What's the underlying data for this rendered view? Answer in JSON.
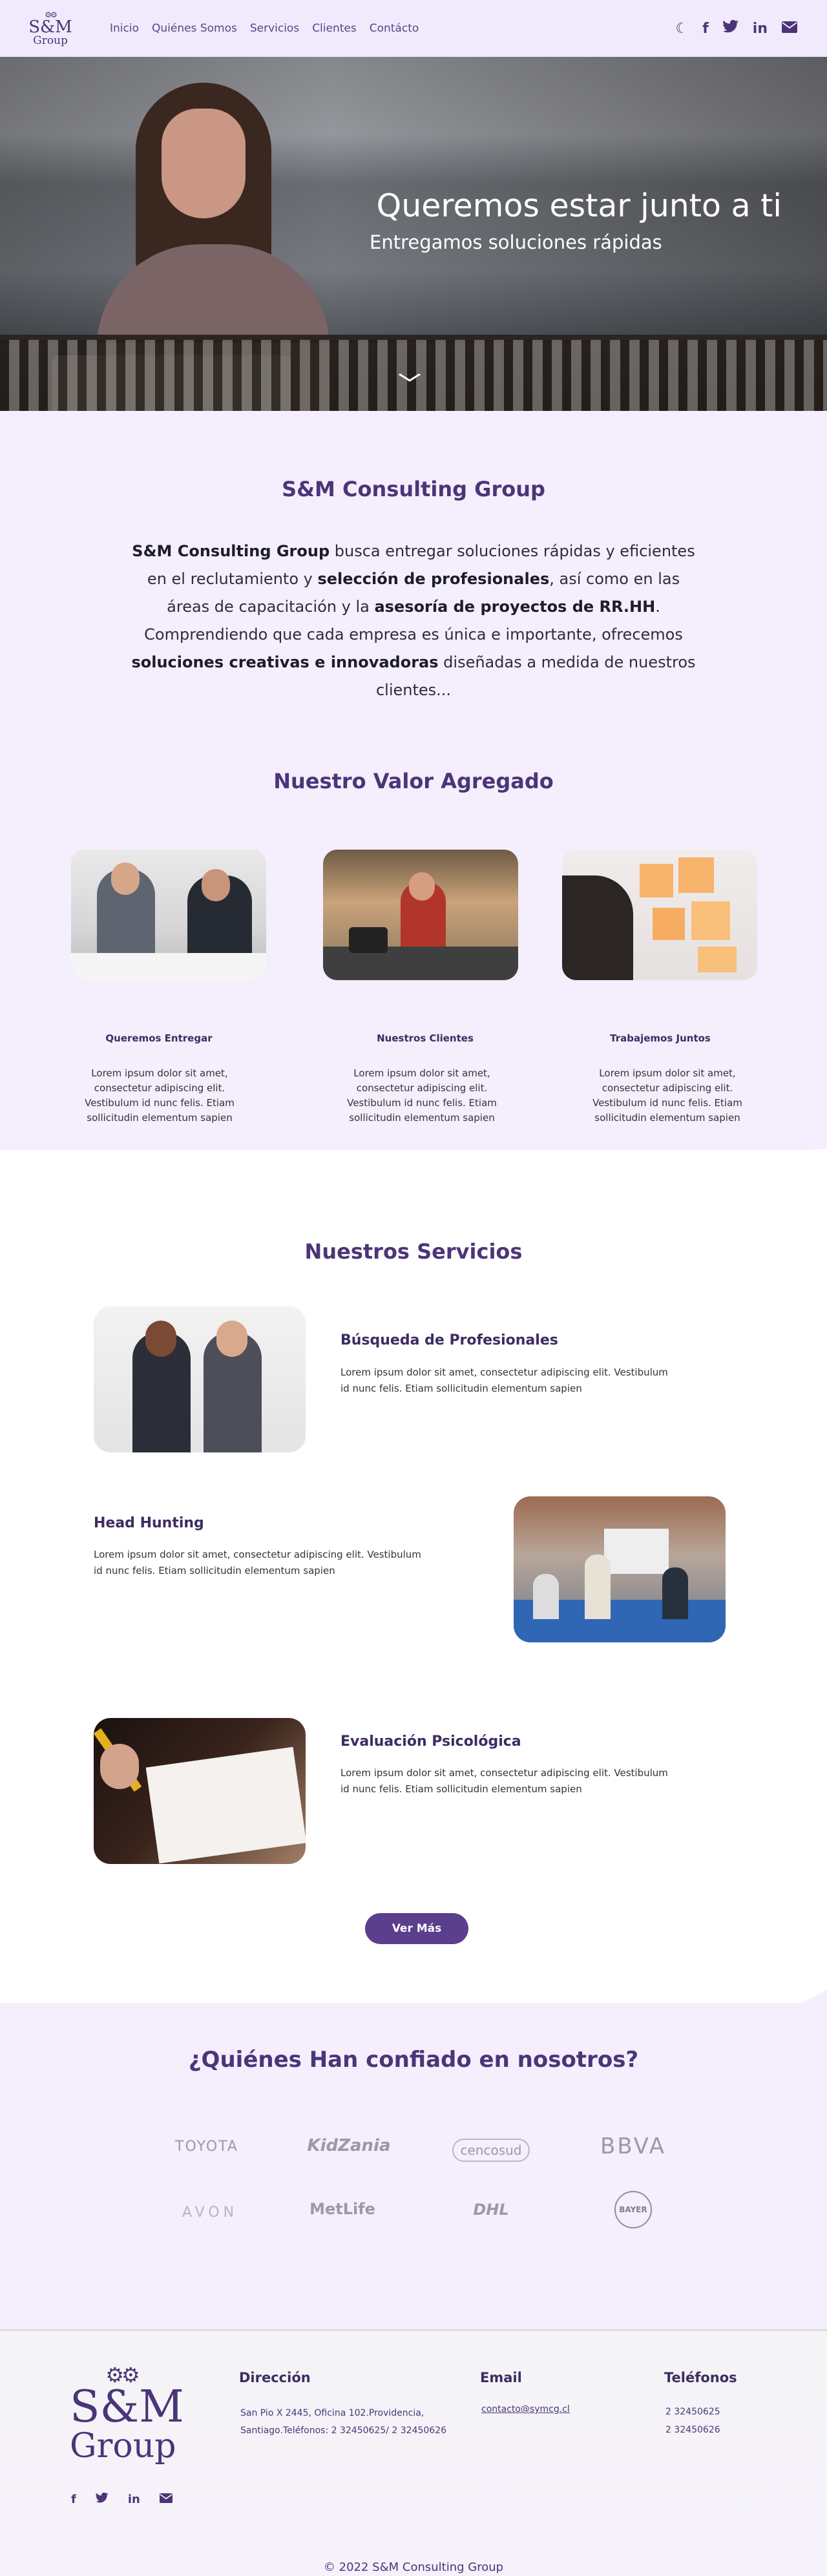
{
  "nav": {
    "logo": {
      "gears": "⚙⚙",
      "sm": "S&M",
      "group": "Group"
    },
    "items": [
      {
        "label": "Inicio"
      },
      {
        "label": "Quiénes Somos"
      },
      {
        "label": "Servicios"
      },
      {
        "label": "Clientes"
      },
      {
        "label": "Contácto"
      }
    ],
    "icons": [
      "moon-icon",
      "facebook-icon",
      "twitter-icon",
      "linkedin-icon",
      "mail-icon"
    ]
  },
  "hero": {
    "title": "Queremos estar junto a ti",
    "subtitle": "Entregamos soluciones rápidas"
  },
  "about": {
    "title": "S&M Consulting Group",
    "p1_bold": "S&M Consulting Group",
    "p1_a": " busca entregar soluciones rápidas y eficientes en el reclutamiento y ",
    "p1_bold2": "selección de profesionales",
    "p1_b": ", así como en las áreas de capacitación y la ",
    "p1_bold3": "asesoría de proyectos de RR.HH",
    "p1_c": ". Comprendiendo que cada empresa es única e importante, ofrecemos ",
    "p1_bold4": "soluciones creativas e innovadoras",
    "p1_d": " diseñadas a medida de nuestros clientes..."
  },
  "valor": {
    "title": "Nuestro Valor Agregado",
    "cards": [
      {
        "title": "Queremos Entregar",
        "text": "Lorem ipsum dolor sit amet, consectetur adipiscing elit. Vestibulum id nunc felis. Etiam sollicitudin elementum sapien"
      },
      {
        "title": "Nuestros Clientes",
        "text": "Lorem ipsum dolor sit amet, consectetur adipiscing elit. Vestibulum id nunc felis. Etiam sollicitudin elementum sapien"
      },
      {
        "title": "Trabajemos Juntos",
        "text": "Lorem ipsum dolor sit amet, consectetur adipiscing elit. Vestibulum id nunc felis. Etiam sollicitudin elementum sapien"
      }
    ]
  },
  "servicios": {
    "title": "Nuestros Servicios",
    "items": [
      {
        "title": "Búsqueda de Profesionales",
        "text": "Lorem ipsum dolor sit amet,  consectetur adipiscing elit. Vestibulum id nunc felis. Etiam sollicitudin elementum sapien"
      },
      {
        "title": "Head Hunting",
        "text": "Lorem ipsum dolor sit amet,  consectetur adipiscing elit. Vestibulum id nunc felis. Etiam sollicitudin elementum sapien"
      },
      {
        "title": "Evaluación Psicológica",
        "text": "Lorem ipsum dolor sit amet,  consectetur adipiscing elit. Vestibulum id nunc felis. Etiam sollicitudin elementum sapien"
      }
    ],
    "button": "Ver Más"
  },
  "clientes": {
    "title": "¿Quiénes Han confiado en nosotros?",
    "logos": [
      "TOYOTA",
      "KidZania",
      "cencosud",
      "BBVA",
      "AVON",
      "MetLife",
      "DHL",
      "BAYER"
    ]
  },
  "footer": {
    "direccion_title": "Dirección",
    "direccion": "San Pio X 2445, Oficina 102.Providencia, Santiago.Teléfonos: 2 32450625/ 2 32450626",
    "email_title": "Email",
    "email": "contacto@symcg.cl",
    "telefonos_title": "Teléfonos",
    "tel1": "2 32450625",
    "tel2": "2 32450626",
    "copyright": "© 2022 S&M Consulting Group"
  },
  "colors": {
    "accent": "#4b3577",
    "button": "#5b3e8c",
    "bg": "#f4eefd"
  }
}
